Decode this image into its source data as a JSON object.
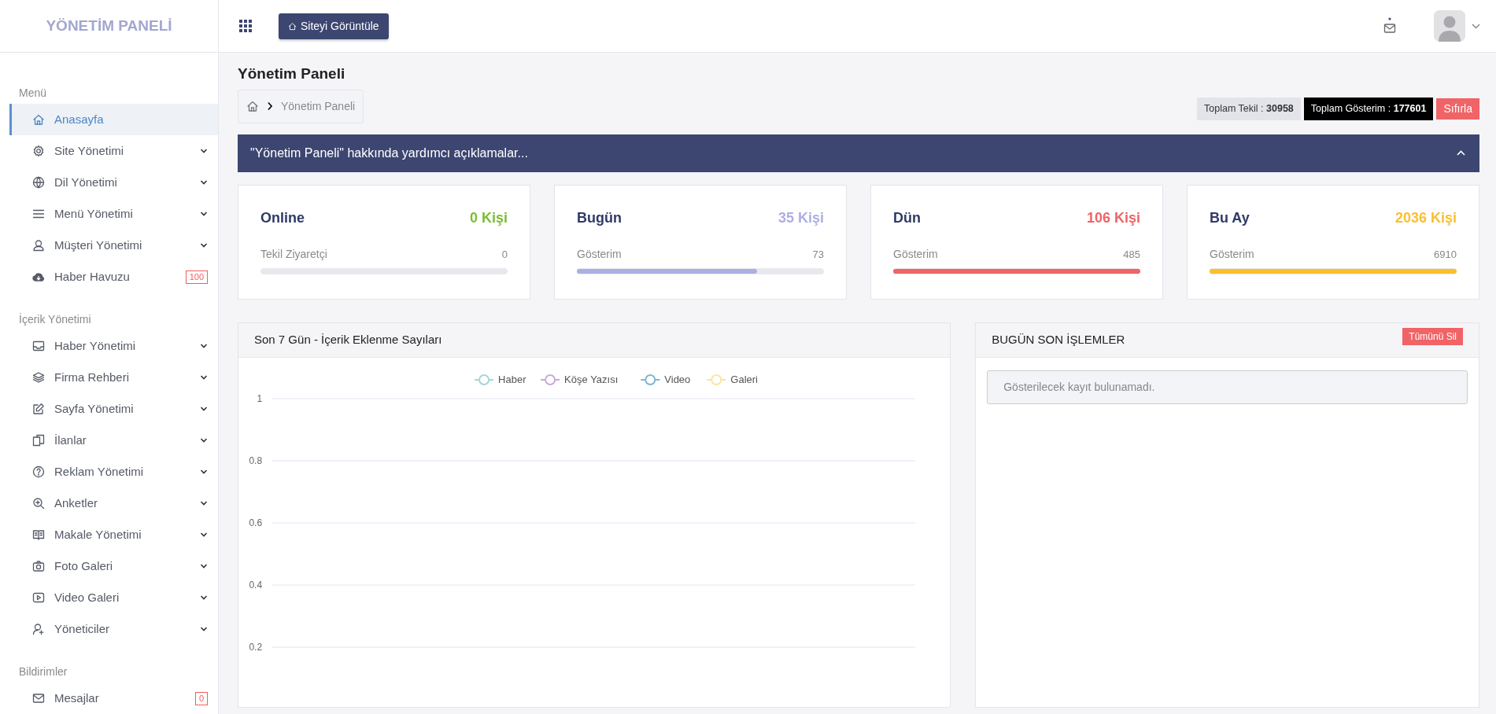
{
  "sidebar": {
    "logo": "YÖNETİM PANELİ",
    "sections": [
      {
        "title": "Menü",
        "items": [
          {
            "label": "Anasayfa",
            "selected": true,
            "expandable": false
          },
          {
            "label": "Site Yönetimi",
            "selected": false,
            "expandable": true
          },
          {
            "label": "Dil Yönetimi",
            "selected": false,
            "expandable": true
          },
          {
            "label": "Menü Yönetimi",
            "selected": false,
            "expandable": true
          },
          {
            "label": "Müşteri Yönetimi",
            "selected": false,
            "expandable": true
          },
          {
            "label": "Haber Havuzu",
            "selected": false,
            "expandable": false,
            "badge": "100"
          }
        ]
      },
      {
        "title": "İçerik Yönetimi",
        "items": [
          {
            "label": "Haber Yönetimi",
            "selected": false,
            "expandable": true
          },
          {
            "label": "Firma Rehberi",
            "selected": false,
            "expandable": true
          },
          {
            "label": "Sayfa Yönetimi",
            "selected": false,
            "expandable": true
          },
          {
            "label": "İlanlar",
            "selected": false,
            "expandable": true
          },
          {
            "label": "Reklam Yönetimi",
            "selected": false,
            "expandable": true
          },
          {
            "label": "Anketler",
            "selected": false,
            "expandable": true
          },
          {
            "label": "Makale Yönetimi",
            "selected": false,
            "expandable": true
          },
          {
            "label": "Foto Galeri",
            "selected": false,
            "expandable": true
          },
          {
            "label": "Video Galeri",
            "selected": false,
            "expandable": true
          },
          {
            "label": "Yöneticiler",
            "selected": false,
            "expandable": true
          }
        ]
      },
      {
        "title": "Bildirimler",
        "items": [
          {
            "label": "Mesajlar",
            "selected": false,
            "expandable": false,
            "badge": "0"
          }
        ]
      }
    ]
  },
  "header": {
    "view_site_button": "Siteyi Görüntüle"
  },
  "page": {
    "title": "Yönetim Paneli",
    "breadcrumb": [
      "Yönetim Paneli"
    ],
    "totals": [
      {
        "text": "Toplam Tekil : **30958**",
        "kind": "light"
      },
      {
        "text": "Toplam Gösterim : **177601**",
        "kind": "dark"
      }
    ],
    "reset_button": "Sıfırla"
  },
  "help_panel": {
    "title": "\"Yönetim Paneli\" hakkında yardımcı açıklamalar..."
  },
  "stats": [
    {
      "title": "Online",
      "value": "0 Kişi",
      "color": "#7cbd32",
      "label": "Tekil Ziyaretçi",
      "count": "0",
      "level": 0
    },
    {
      "title": "Bugün",
      "value": "35 Kişi",
      "color": "#adaee3",
      "label": "Gösterim",
      "count": "73",
      "level": 0.73
    },
    {
      "title": "Dün",
      "value": "106 Kişi",
      "color": "#f06366",
      "label": "Gösterim",
      "count": "485",
      "level": 1
    },
    {
      "title": "Bu Ay",
      "value": "2036 Kişi",
      "color": "#fbbf2c",
      "label": "Gösterim",
      "count": "6910",
      "level": 1
    }
  ],
  "content_chart": {
    "title": "Son 7 Gün - İçerik Eklenme Sayıları",
    "chart_data": {
      "type": "line",
      "series": [
        {
          "name": "Haber",
          "color": "#a3d6dc"
        },
        {
          "name": "Köşe Yazısı",
          "color": "#c9a9dc"
        },
        {
          "name": "Video",
          "color": "#80b6cf"
        },
        {
          "name": "Galeri",
          "color": "#fde3a4"
        }
      ],
      "grid": true,
      "ylim": [
        0.2,
        1
      ],
      "yticks": [
        0.2,
        0.4,
        0.6,
        0.8,
        1
      ]
    }
  },
  "recent_actions": {
    "title": "BUGÜN SON İŞLEMLER",
    "clear_button": "Tümünü Sil",
    "empty_message": "Gösterilecek kayıt bulunamadı."
  }
}
